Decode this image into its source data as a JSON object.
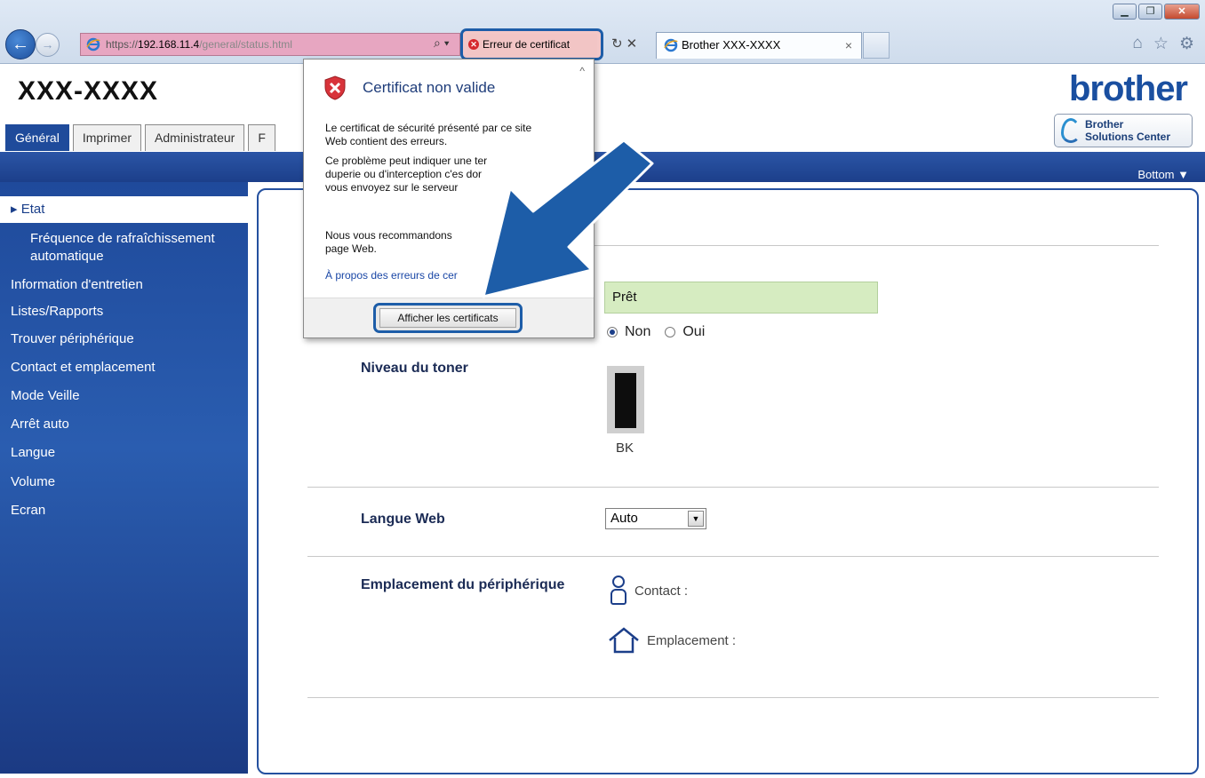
{
  "browser": {
    "address_prefix": "https://",
    "address_host": "192.168.11.4",
    "address_path": "/general/status.html",
    "cert_error_label": "Erreur de certificat",
    "tab_title": "Brother XXX-XXXX",
    "tab_close": "×"
  },
  "header": {
    "model": "XXX-XXXX",
    "brand": "brother",
    "solutions_line1": "Brother",
    "solutions_line2": "Solutions Center"
  },
  "nav_tabs": {
    "general": "Général",
    "print": "Imprimer",
    "admin": "Administrateur",
    "partial": "F"
  },
  "band": {
    "bottom_link": "Bottom ▼"
  },
  "sidebar": {
    "items": [
      "▸ Etat",
      "Fréquence de rafraîchissement",
      "automatique",
      "Information d'entretien",
      "Listes/Rapports",
      "Trouver périphérique",
      "Contact et emplacement",
      "Mode Veille",
      "Arrêt auto",
      "Langue",
      "Volume",
      "Ecran"
    ]
  },
  "content": {
    "status_value": "Prêt",
    "radio_non": "Non",
    "radio_oui": "Oui",
    "toner_label": "Niveau du toner",
    "toner_name": "BK",
    "web_lang_label": "Langue Web",
    "web_lang_value": "Auto",
    "location_label": "Emplacement du périphérique",
    "contact_label": "Contact :",
    "emplacement_label": "Emplacement :"
  },
  "popup": {
    "title": "Certificat non valide",
    "para1_line1": "Le certificat de sécurité présenté par ce site",
    "para1_line2": "Web contient des erreurs.",
    "para2_line1": "Ce problème peut indiquer une ter",
    "para2_line2": "duperie ou d'interception c'es dor",
    "para2_line3": "vous envoyez sur le serveur",
    "para3_line1": "Nous vous recommandons",
    "para3_line2": "page Web.",
    "link": "À propos des erreurs de cer",
    "view_button": "Afficher les certificats"
  },
  "colors": {
    "accent_blue": "#1d5da8",
    "sidebar_blue": "#1f4a9b",
    "status_green": "#d6ecc1"
  }
}
